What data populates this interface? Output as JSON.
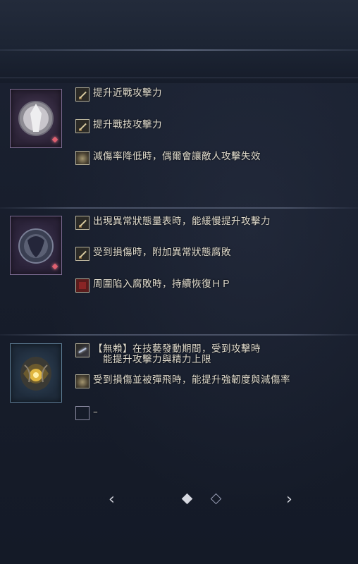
{
  "items": [
    {
      "thumb_name": "item-thumbnail-white-shield",
      "has_gem": true,
      "effects": [
        {
          "icon": "sword-icon",
          "text": "提升近戰攻擊力"
        },
        {
          "icon": "sword-icon",
          "text": "提升戰技攻擊力"
        },
        {
          "icon": "shield-icon",
          "text": "減傷率降低時，偶爾會讓敵人攻擊失效"
        }
      ]
    },
    {
      "thumb_name": "item-thumbnail-dark-shield",
      "has_gem": true,
      "effects": [
        {
          "icon": "sword-icon",
          "text": "出現異常狀態量表時，能緩慢提升攻擊力"
        },
        {
          "icon": "sword-icon",
          "text": "受到損傷時，附加異常狀態腐敗"
        },
        {
          "icon": "red-square-icon",
          "text": "周圍陷入腐敗時，持續恢復ＨＰ"
        }
      ]
    },
    {
      "thumb_name": "item-thumbnail-gold-relic",
      "has_gem": false,
      "effects": [
        {
          "icon": "spark-icon",
          "text": "【無賴】在技藝發動期間，受到攻擊時\n　能提升攻擊力與精力上限"
        },
        {
          "icon": "shield-icon",
          "text": "受到損傷並被彈飛時，能提升強韌度與減傷率"
        },
        {
          "icon": "empty-slot-icon",
          "text": "–"
        }
      ]
    }
  ],
  "pagination": {
    "prev": "‹",
    "next": "›",
    "current_page": 1,
    "total_pages": 2
  }
}
